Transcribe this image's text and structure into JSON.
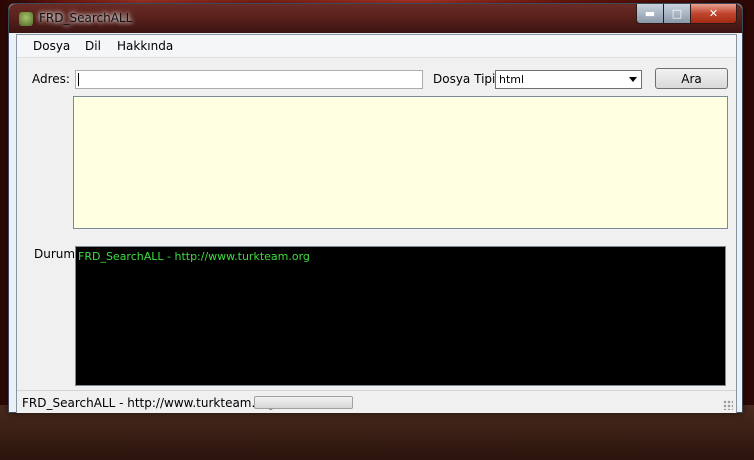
{
  "window": {
    "title": "FRD_SearchALL"
  },
  "menu": {
    "items": [
      "Dosya",
      "Dil",
      "Hakkında"
    ]
  },
  "form": {
    "address_label": "Adres:",
    "address_value": "",
    "file_type_label": "Dosya Tipi:",
    "file_type_selected": "html",
    "search_button": "Ara"
  },
  "status": {
    "label": "Durum:",
    "log_line": "FRD_SearchALL - http://www.turkteam.org"
  },
  "statusbar": {
    "text": "FRD_SearchALL - http://www.turkteam.org",
    "progress": 0
  },
  "colors": {
    "results_bg": "#ffffe1",
    "log_bg": "#000000",
    "log_text": "#3dde3d"
  },
  "icons": {
    "app": "app-icon",
    "minimize": "minimize-icon",
    "maximize": "maximize-icon",
    "close": "close-icon",
    "dropdown": "chevron-down-icon",
    "resize": "resize-grip-icon"
  }
}
